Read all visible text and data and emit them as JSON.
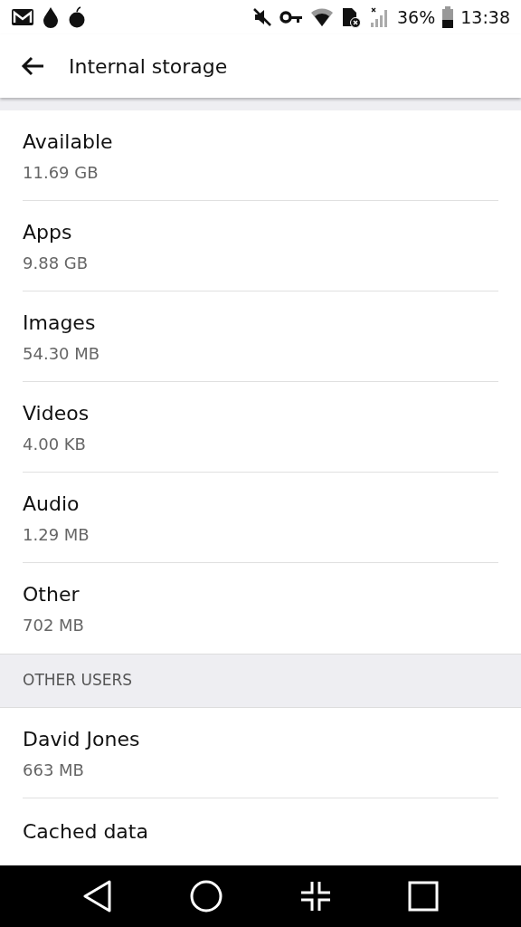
{
  "status_bar": {
    "battery": "36%",
    "time": "13:38"
  },
  "app_bar": {
    "title": "Internal storage"
  },
  "items": [
    {
      "title": "Available",
      "value": "11.69 GB"
    },
    {
      "title": "Apps",
      "value": "9.88 GB"
    },
    {
      "title": "Images",
      "value": "54.30 MB"
    },
    {
      "title": "Videos",
      "value": "4.00 KB"
    },
    {
      "title": "Audio",
      "value": "1.29 MB"
    },
    {
      "title": "Other",
      "value": "702 MB"
    }
  ],
  "other_users": {
    "header": "OTHER USERS",
    "items": [
      {
        "title": "David Jones",
        "value": "663 MB"
      },
      {
        "title": "Cached data"
      }
    ]
  }
}
